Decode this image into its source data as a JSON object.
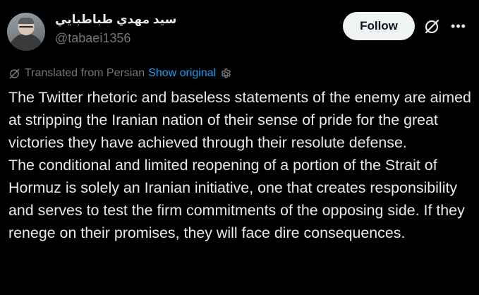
{
  "author": {
    "display_name": "سيد مهدي طباطبايي",
    "handle": "@tabaei1356"
  },
  "actions": {
    "follow_label": "Follow",
    "grok_icon": "grok-icon",
    "more_icon": "more-dots-icon"
  },
  "translation": {
    "notice": "Translated from Persian",
    "show_original": "Show original",
    "icon": "translate-icon",
    "settings_icon": "gear-icon"
  },
  "tweet": {
    "paragraphs": [
      "The Twitter rhetoric and baseless statements of the enemy are aimed at stripping the Iranian nation of their sense of pride for the great victories they have achieved through their resolute defense.",
      "The conditional and limited reopening of a portion of the Strait of Hormuz is solely an Iranian initiative, one that creates responsibility and serves to test the firm commitments of the opposing side. If they renege on their promises, they will face dire consequences."
    ]
  },
  "colors": {
    "background": "#000000",
    "text": "#e7e9ea",
    "secondary": "#71767b",
    "link": "#1d9bf0",
    "follow_bg": "#eff3f4"
  }
}
